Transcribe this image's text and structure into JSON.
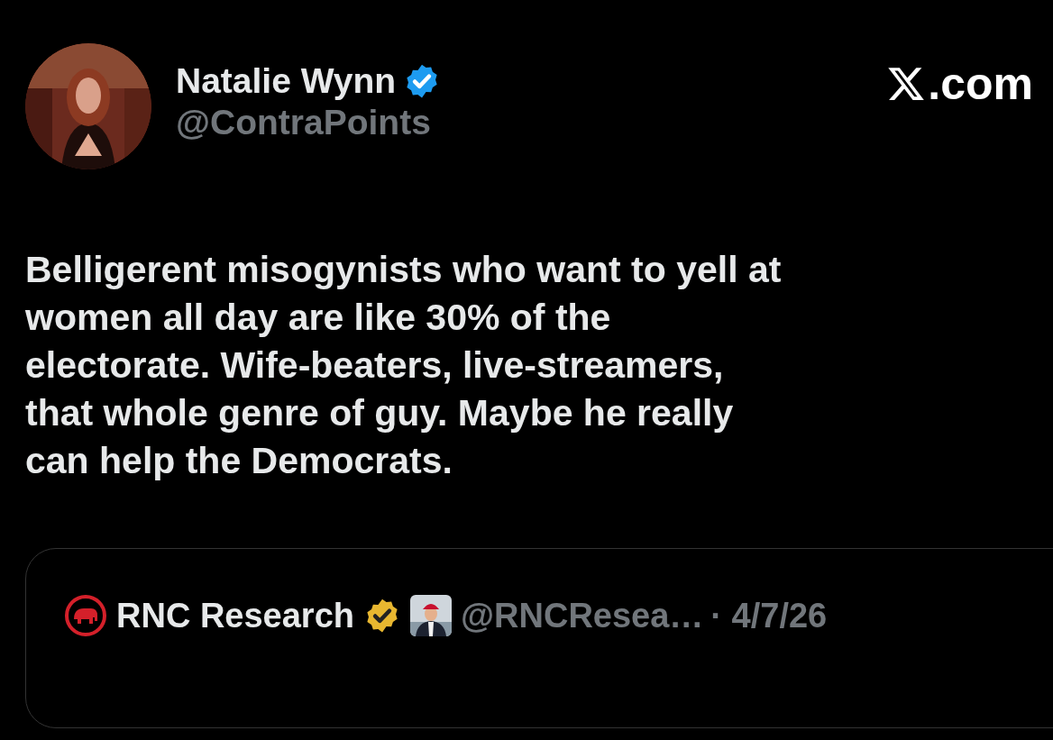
{
  "post": {
    "author": {
      "name": "Natalie Wynn",
      "badge": {
        "color": "#1d9bf0"
      },
      "handle": "@ContraPoints"
    },
    "site_suffix": ".com",
    "text": "Belligerent misogynists who want to yell at\nwomen all day are like 30% of the\nelectorate. Wife-beaters, live-streamers,\nthat whole genre of guy. Maybe he really\ncan help the Democrats.",
    "quote": {
      "author": {
        "name": "RNC Research",
        "badge": {
          "color": "#e8b730"
        },
        "handle": "@RNCResea…",
        "date": "· 4/7/26"
      }
    }
  }
}
